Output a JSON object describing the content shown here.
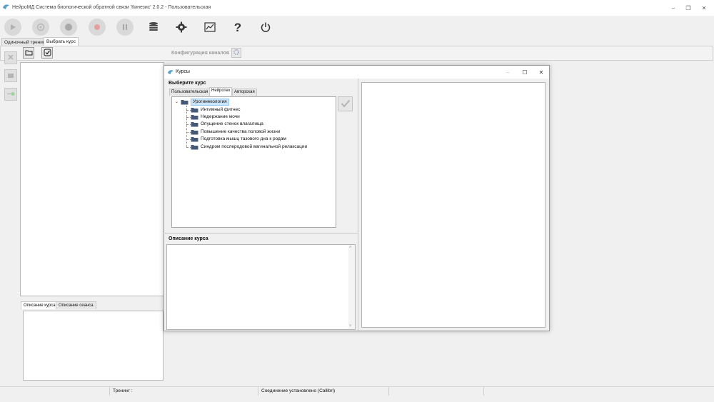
{
  "app": {
    "title": "НейроМД Система биологической обратной связи 'Кинезис' 2.0.2 - Пользовательская"
  },
  "main_tabs": [
    {
      "label": "Одиночный тренинг"
    },
    {
      "label": "Выбрать курс"
    }
  ],
  "config_label": "Конфигурация каналов",
  "lower_tabs": [
    {
      "label": "Описание курса"
    },
    {
      "label": "Описание сеанса"
    }
  ],
  "status": {
    "training_label": "Тренинг :",
    "connection": "Соединение установлено (Callibri)"
  },
  "dialog": {
    "title": "Курсы",
    "choose_label": "Выберите курс",
    "tabs": [
      {
        "label": "Пользовательская"
      },
      {
        "label": "Нейротех"
      },
      {
        "label": "Авторская"
      }
    ],
    "tree": {
      "root": "Урогинекология",
      "children": [
        "Интимный фитнес",
        "Недержание мочи",
        "Опущение стенок влагалища",
        "Повышение качества половой жизни",
        "Подготовка мышц тазового дна к родам",
        "Синдром послеродовой вагинальной релаксации"
      ]
    },
    "description_label": "Описание курса"
  },
  "colors": {
    "accent_blue": "#1e6fb8",
    "selection": "#cce4f7",
    "record_red": "#e4a0a0"
  }
}
